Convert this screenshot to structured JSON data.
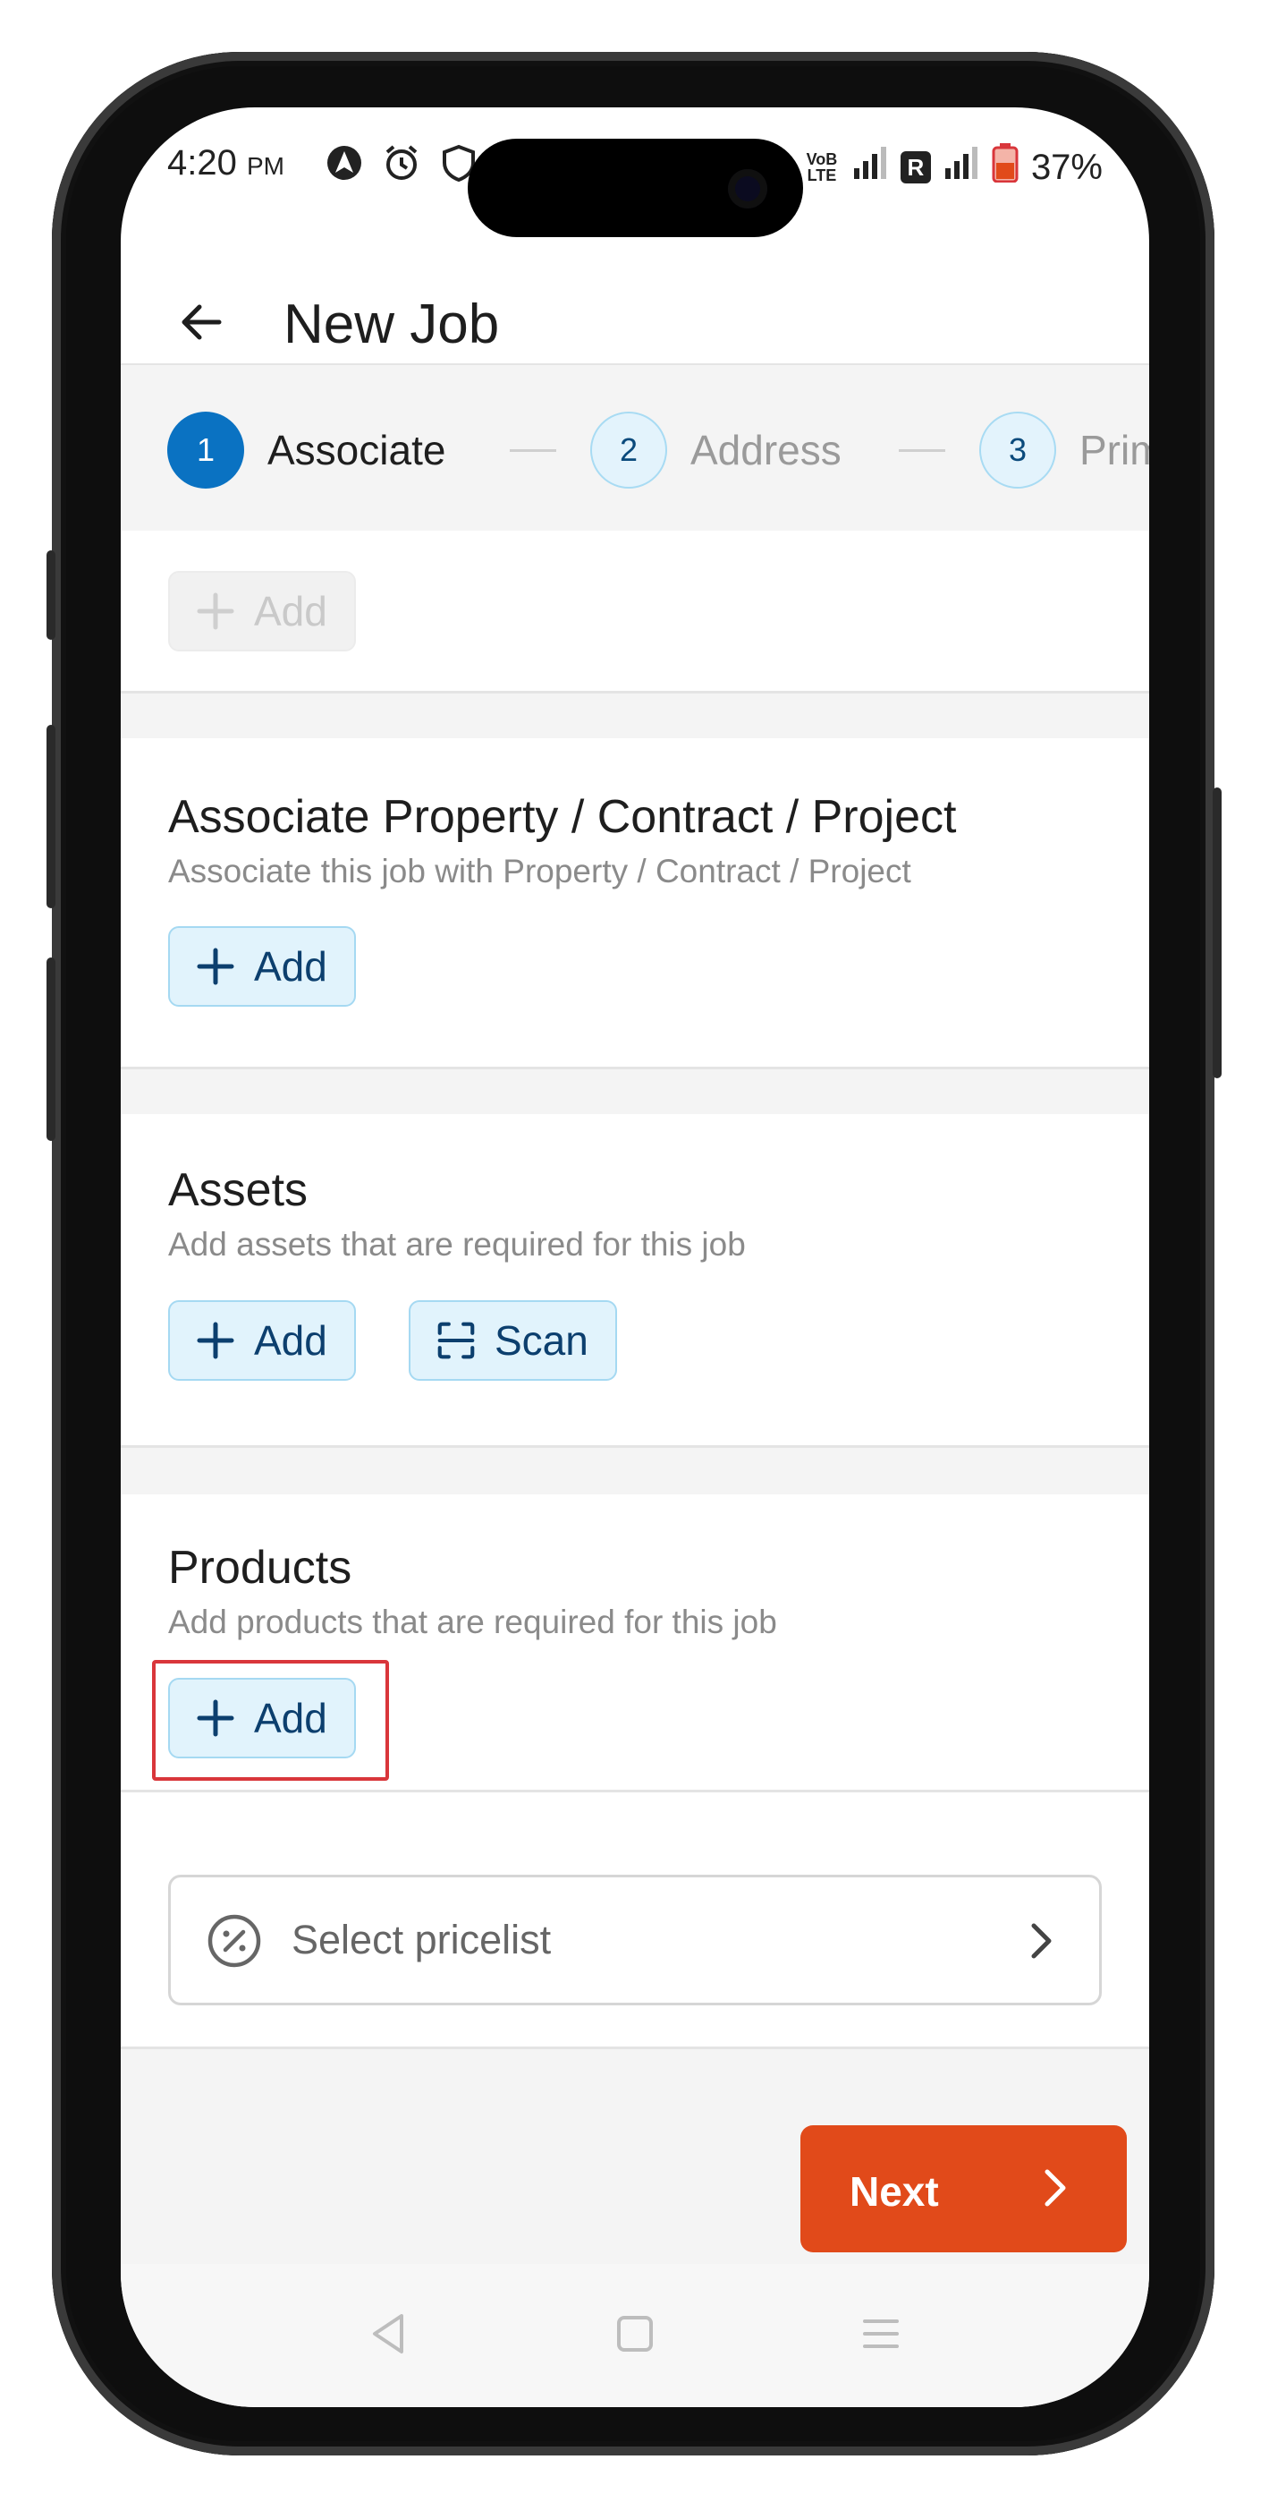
{
  "status_bar": {
    "time": "4:20",
    "ampm": "PM",
    "carrier_label": "VoB LTE",
    "roaming_label": "R",
    "battery": "37%"
  },
  "header": {
    "title": "New Job"
  },
  "stepper": {
    "steps": [
      {
        "number": "1",
        "label": "Associate"
      },
      {
        "number": "2",
        "label": "Address"
      },
      {
        "number": "3",
        "label": "Prim"
      }
    ]
  },
  "top_section": {
    "add_label": "Add"
  },
  "associate_section": {
    "title": "Associate Property / Contract / Project",
    "subtitle": "Associate this job with Property / Contract / Project",
    "add_label": "Add"
  },
  "assets_section": {
    "title": "Assets",
    "subtitle": "Add assets that are required for this job",
    "add_label": "Add",
    "scan_label": "Scan"
  },
  "products_section": {
    "title": "Products",
    "subtitle": "Add products that are required for this job",
    "add_label": "Add"
  },
  "pricelist": {
    "label": "Select pricelist"
  },
  "footer": {
    "next_label": "Next"
  },
  "colors": {
    "accent_blue": "#0a72c2",
    "next_orange": "#e14a1a",
    "highlight_red": "#d9363b"
  }
}
